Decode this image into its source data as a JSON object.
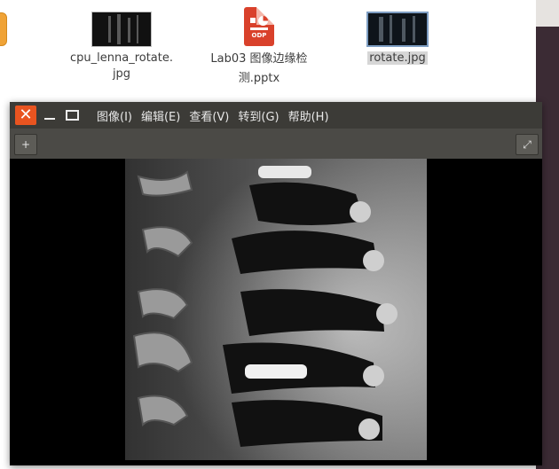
{
  "desktop": {
    "files": [
      {
        "name": "cpu_lenna_rotate.\njpg",
        "line1": "cpu_lenna_rotate.",
        "line2": "jpg",
        "icon": "image-thumbnail"
      },
      {
        "line1": "Lab03 图像边缘检",
        "line2": "测.pptx",
        "icon": "odp-presentation-icon",
        "icon_label": "ODP"
      },
      {
        "line1": "rotate.jpg",
        "icon": "image-thumbnail",
        "selected": true
      }
    ]
  },
  "viewer": {
    "menu": [
      "图像(I)",
      "编辑(E)",
      "查看(V)",
      "转到(G)",
      "帮助(H)"
    ],
    "close_icon": "close-icon",
    "minimize_icon": "minimize-icon",
    "maximize_icon": "maximize-icon",
    "toolbar": {
      "sidebar_button_glyph": "+",
      "fullscreen_button_glyph": "⤢"
    }
  },
  "colors": {
    "accent": "#e95420",
    "titlebar": "#3c3b37",
    "toolbar": "#4b4a46"
  }
}
